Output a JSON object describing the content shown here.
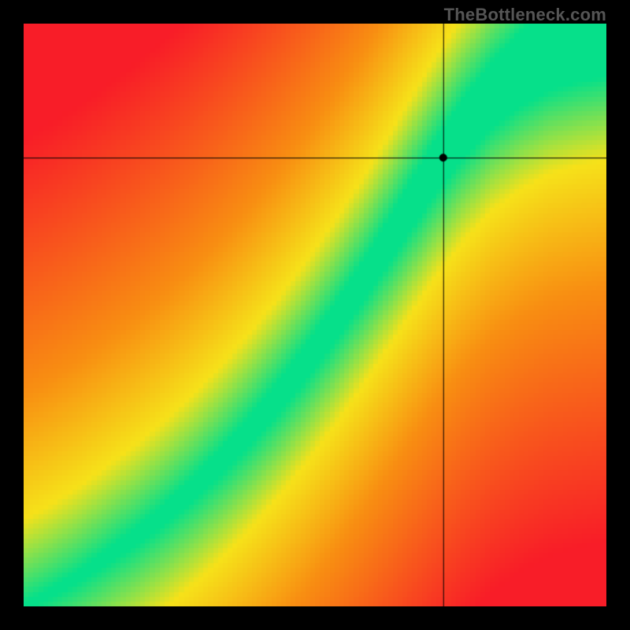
{
  "watermark": "TheBottleneck.com",
  "chart_data": {
    "type": "heatmap",
    "title": "",
    "xlabel": "",
    "ylabel": "",
    "xlim": [
      0,
      1
    ],
    "ylim": [
      0,
      1
    ],
    "grid": false,
    "legend": false,
    "resolution": 120,
    "curve_description": "Green optimal band follows a monotone increasing nonlinear curve from lower-left to upper-right; red indicates strong mismatch, yellow intermediate.",
    "crosshair": {
      "x": 0.72,
      "y": 0.77
    },
    "marker": {
      "x": 0.72,
      "y": 0.77,
      "label": ""
    },
    "band_center_samples": {
      "x": [
        0.0,
        0.05,
        0.1,
        0.15,
        0.2,
        0.25,
        0.3,
        0.35,
        0.4,
        0.45,
        0.5,
        0.55,
        0.6,
        0.65,
        0.7,
        0.75,
        0.8,
        0.85,
        0.9,
        0.95,
        1.0
      ],
      "y": [
        0.0,
        0.025,
        0.055,
        0.09,
        0.125,
        0.165,
        0.21,
        0.26,
        0.315,
        0.375,
        0.44,
        0.51,
        0.585,
        0.665,
        0.745,
        0.815,
        0.875,
        0.92,
        0.955,
        0.98,
        1.0
      ]
    },
    "band_halfwidth_samples": {
      "x": [
        0.0,
        0.1,
        0.2,
        0.3,
        0.4,
        0.5,
        0.6,
        0.7,
        0.8,
        0.9,
        1.0
      ],
      "w": [
        0.005,
        0.01,
        0.015,
        0.02,
        0.025,
        0.03,
        0.035,
        0.045,
        0.055,
        0.07,
        0.09
      ]
    },
    "color_stops": {
      "good": "#06e08a",
      "warn": "#f6e21a",
      "mid": "#f98f12",
      "bad": "#f81d28"
    }
  }
}
